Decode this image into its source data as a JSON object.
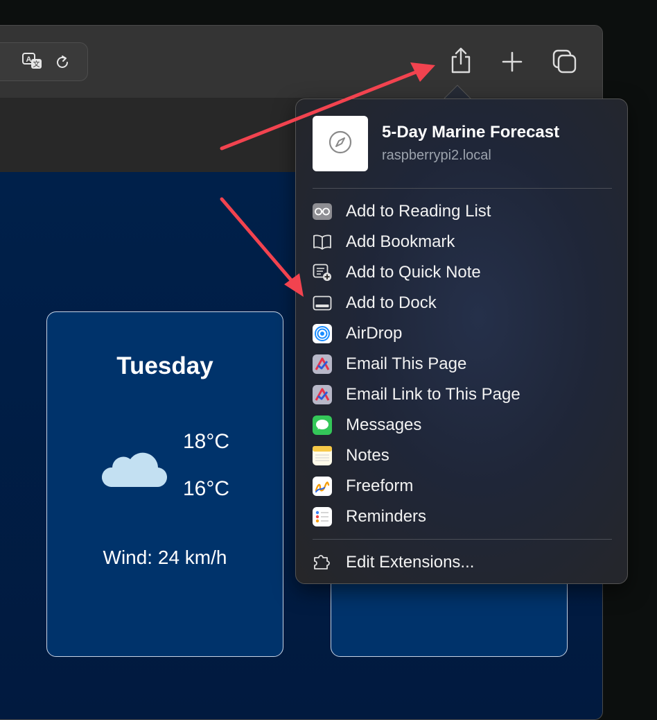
{
  "toolbar": {
    "translate_icon": "translate-icon",
    "reload_icon": "reload-icon",
    "share_icon": "share-icon",
    "new_tab_icon": "plus-icon",
    "tabs_overview_icon": "tabs-overview-icon"
  },
  "card": {
    "day": "Tuesday",
    "high": "18°C",
    "low": "16°C",
    "wind": "Wind: 24 km/h",
    "weather_icon": "cloud-icon"
  },
  "share_menu": {
    "title": "5-Day Marine Forecast",
    "subtitle": "raspberrypi2.local",
    "thumbnail_icon": "compass-icon",
    "items": [
      {
        "label": "Add to Reading List",
        "icon": "glasses-icon"
      },
      {
        "label": "Add Bookmark",
        "icon": "book-icon"
      },
      {
        "label": "Add to Quick Note",
        "icon": "quick-note-icon"
      },
      {
        "label": "Add to Dock",
        "icon": "dock-icon"
      },
      {
        "label": "AirDrop",
        "icon": "airdrop-icon"
      },
      {
        "label": "Email This Page",
        "icon": "mail-app-icon"
      },
      {
        "label": "Email Link to This Page",
        "icon": "mail-app-icon"
      },
      {
        "label": "Messages",
        "icon": "messages-icon"
      },
      {
        "label": "Notes",
        "icon": "notes-icon"
      },
      {
        "label": "Freeform",
        "icon": "freeform-icon"
      },
      {
        "label": "Reminders",
        "icon": "reminders-icon"
      }
    ],
    "edit_extensions": {
      "label": "Edit Extensions...",
      "icon": "extensions-icon"
    }
  },
  "colors": {
    "annotation_arrow": "#f2434f",
    "page_background": "#00204a",
    "card_background": "#00336b"
  }
}
